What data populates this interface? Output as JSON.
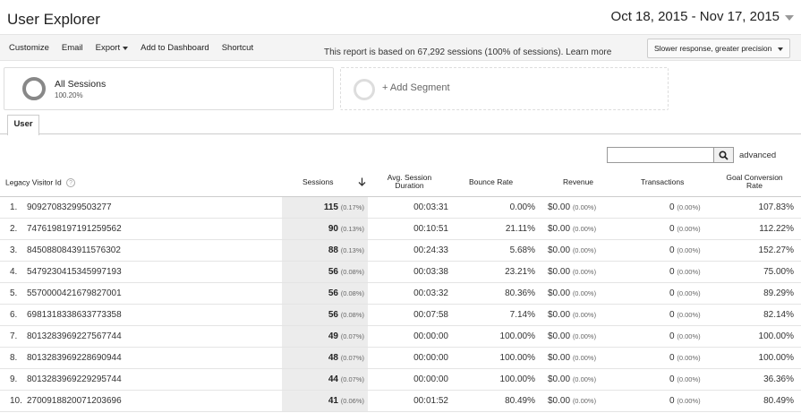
{
  "header": {
    "title": "User Explorer",
    "date_range": "Oct 18, 2015 - Nov 17, 2015"
  },
  "toolbar": {
    "customize": "Customize",
    "email": "Email",
    "export": "Export",
    "add_dashboard": "Add to Dashboard",
    "shortcut": "Shortcut",
    "notice": "This report is based on 67,292 sessions (100% of sessions). Learn more",
    "precision": "Slower response, greater precision"
  },
  "segments": {
    "all_name": "All Sessions",
    "all_pct": "100.20%",
    "add_label": "+ Add Segment"
  },
  "tabs": {
    "user": "User"
  },
  "search": {
    "advanced": "advanced"
  },
  "columns": {
    "visitor_id": "Legacy Visitor Id",
    "sessions": "Sessions",
    "duration": "Avg. Session Duration",
    "bounce": "Bounce Rate",
    "revenue": "Revenue",
    "transactions": "Transactions",
    "goal": "Goal Conversion Rate"
  },
  "rows": [
    {
      "rank": "1.",
      "id": "90927083299503277",
      "sessions": "115",
      "sess_pct": "(0.17%)",
      "duration": "00:03:31",
      "bounce": "0.00%",
      "revenue": "$0.00",
      "rev_pct": "(0.00%)",
      "trans": "0",
      "trans_pct": "(0.00%)",
      "goal": "107.83%"
    },
    {
      "rank": "2.",
      "id": "7476198197191259562",
      "sessions": "90",
      "sess_pct": "(0.13%)",
      "duration": "00:10:51",
      "bounce": "21.11%",
      "revenue": "$0.00",
      "rev_pct": "(0.00%)",
      "trans": "0",
      "trans_pct": "(0.00%)",
      "goal": "112.22%"
    },
    {
      "rank": "3.",
      "id": "8450880843911576302",
      "sessions": "88",
      "sess_pct": "(0.13%)",
      "duration": "00:24:33",
      "bounce": "5.68%",
      "revenue": "$0.00",
      "rev_pct": "(0.00%)",
      "trans": "0",
      "trans_pct": "(0.00%)",
      "goal": "152.27%"
    },
    {
      "rank": "4.",
      "id": "5479230415345997193",
      "sessions": "56",
      "sess_pct": "(0.08%)",
      "duration": "00:03:38",
      "bounce": "23.21%",
      "revenue": "$0.00",
      "rev_pct": "(0.00%)",
      "trans": "0",
      "trans_pct": "(0.00%)",
      "goal": "75.00%"
    },
    {
      "rank": "5.",
      "id": "5570000421679827001",
      "sessions": "56",
      "sess_pct": "(0.08%)",
      "duration": "00:03:32",
      "bounce": "80.36%",
      "revenue": "$0.00",
      "rev_pct": "(0.00%)",
      "trans": "0",
      "trans_pct": "(0.00%)",
      "goal": "89.29%"
    },
    {
      "rank": "6.",
      "id": "6981318338633773358",
      "sessions": "56",
      "sess_pct": "(0.08%)",
      "duration": "00:07:58",
      "bounce": "7.14%",
      "revenue": "$0.00",
      "rev_pct": "(0.00%)",
      "trans": "0",
      "trans_pct": "(0.00%)",
      "goal": "82.14%"
    },
    {
      "rank": "7.",
      "id": "8013283969227567744",
      "sessions": "49",
      "sess_pct": "(0.07%)",
      "duration": "00:00:00",
      "bounce": "100.00%",
      "revenue": "$0.00",
      "rev_pct": "(0.00%)",
      "trans": "0",
      "trans_pct": "(0.00%)",
      "goal": "100.00%"
    },
    {
      "rank": "8.",
      "id": "8013283969228690944",
      "sessions": "48",
      "sess_pct": "(0.07%)",
      "duration": "00:00:00",
      "bounce": "100.00%",
      "revenue": "$0.00",
      "rev_pct": "(0.00%)",
      "trans": "0",
      "trans_pct": "(0.00%)",
      "goal": "100.00%"
    },
    {
      "rank": "9.",
      "id": "8013283969229295744",
      "sessions": "44",
      "sess_pct": "(0.07%)",
      "duration": "00:00:00",
      "bounce": "100.00%",
      "revenue": "$0.00",
      "rev_pct": "(0.00%)",
      "trans": "0",
      "trans_pct": "(0.00%)",
      "goal": "36.36%"
    },
    {
      "rank": "10.",
      "id": "2700918820071203696",
      "sessions": "41",
      "sess_pct": "(0.06%)",
      "duration": "00:01:52",
      "bounce": "80.49%",
      "revenue": "$0.00",
      "rev_pct": "(0.00%)",
      "trans": "0",
      "trans_pct": "(0.00%)",
      "goal": "80.49%"
    }
  ]
}
